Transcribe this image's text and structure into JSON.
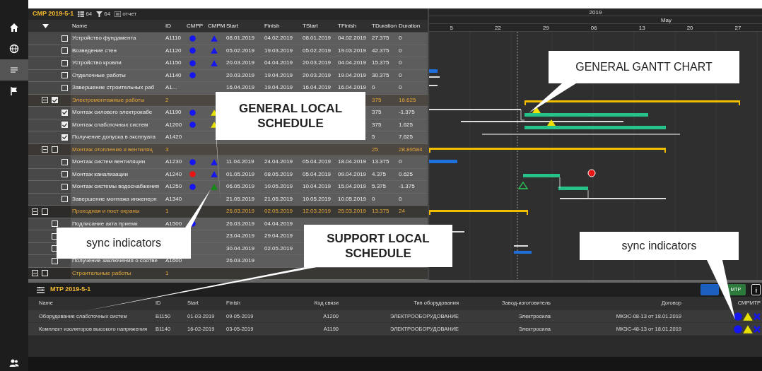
{
  "sidebar": {
    "items": [
      {
        "kind": "home",
        "selected": false
      },
      {
        "kind": "globe",
        "selected": false
      },
      {
        "kind": "list",
        "selected": true
      },
      {
        "kind": "flag",
        "selected": false
      }
    ],
    "bottom": {
      "kind": "users"
    }
  },
  "schedule": {
    "title": "CMP 2019-5-1",
    "tools": [
      {
        "kind": "grid",
        "text": "64"
      },
      {
        "kind": "filter",
        "text": "64"
      },
      {
        "kind": "report",
        "text": "отчет"
      }
    ],
    "columns": [
      "Name",
      "ID",
      "CMPP",
      "CMPM",
      "Start",
      "Finish",
      "TStart",
      "TFinish",
      "TDuration",
      "Duration"
    ],
    "rows": [
      {
        "kind": "continuation",
        "children": [
          {
            "kind": "continuation",
            "children": [
              {
                "kind": "task",
                "checked": false,
                "name": "Устройство фундамента",
                "id": "A1110",
                "cmpp": {
                  "color": "#1515f0"
                },
                "cmpm": {
                  "color": "#1515f0"
                },
                "start": "08.01.2019",
                "finish": "04.02.2019",
                "tstart": "08.01.2019",
                "tfinish": "04.02.2019",
                "tduration": "27.375",
                "duration": "0"
              },
              {
                "kind": "task",
                "checked": false,
                "name": "Возведение стен",
                "id": "A1120",
                "cmpp": {
                  "color": "#1515f0"
                },
                "cmpm": {
                  "color": "#1515f0"
                },
                "start": "05.02.2019",
                "finish": "19.03.2019",
                "tstart": "05.02.2019",
                "tfinish": "19.03.2019",
                "tduration": "42.375",
                "duration": "0"
              },
              {
                "kind": "task",
                "checked": false,
                "name": "Устройство кровли",
                "id": "A1150",
                "cmpp": {
                  "color": "#1515f0"
                },
                "cmpm": {
                  "color": "#1515f0"
                },
                "start": "20.03.2019",
                "finish": "04.04.2019",
                "tstart": "20.03.2019",
                "tfinish": "04.04.2019",
                "tduration": "15.375",
                "duration": "0"
              },
              {
                "kind": "task",
                "checked": false,
                "name": "Отделочные работы",
                "id": "A1140",
                "cmpp": {
                  "color": "#1515f0"
                },
                "start": "20.03.2019",
                "finish": "19.04.2019",
                "tstart": "20.03.2019",
                "tfinish": "19.04.2019",
                "tduration": "30.375",
                "duration": "0"
              },
              {
                "kind": "task",
                "checked": false,
                "name": "Завершение строительных раб",
                "id": "A1...",
                "start": "16.04.2019",
                "finish": "19.04.2019",
                "tstart": "16.04.2019",
                "tfinish": "16.04.2019",
                "tduration": "0",
                "duration": "0"
              }
            ]
          },
          {
            "kind": "group",
            "expanded": true,
            "checked": true,
            "name": "Электромонтажные работы",
            "id": "2",
            "tduration": "375",
            "duration": "16.625",
            "children": [
              {
                "kind": "task",
                "checked": true,
                "name": "Монтаж силового электрокабе",
                "id": "A1190",
                "cmpp": {
                  "color": "#1515f0"
                },
                "cmpm": {
                  "color": "#e8e000"
                },
                "tduration": "375",
                "duration": "-1.375"
              },
              {
                "kind": "task",
                "checked": true,
                "name": "Монтаж слаботочных систем",
                "id": "A1200",
                "cmpp": {
                  "color": "#1515f0"
                },
                "cmpm": {
                  "color": "#e8e000"
                },
                "tduration": "375",
                "duration": "1.625"
              },
              {
                "kind": "task",
                "checked": true,
                "name": "Получение допуска в эксплуата",
                "id": "A1420",
                "tduration": "5",
                "duration": "7.625"
              }
            ]
          },
          {
            "kind": "group",
            "expanded": true,
            "checked": false,
            "name": "Монтаж отопления и вентиляц",
            "id": "3",
            "tduration": "25",
            "duration": "28.89584",
            "children": [
              {
                "kind": "task",
                "checked": false,
                "name": "Монтаж систем вентиляции",
                "id": "A1230",
                "cmpp": {
                  "color": "#1515f0"
                },
                "cmpm": {
                  "color": "#1515f0"
                },
                "start": "11.04.2019",
                "finish": "24.04.2019",
                "tstart": "05.04.2019",
                "tfinish": "18.04.2019",
                "tduration": "13.375",
                "duration": "0"
              },
              {
                "kind": "task",
                "checked": false,
                "name": "Монтаж канализации",
                "id": "A1240",
                "cmpp": {
                  "color": "#e81515"
                },
                "cmpm": {
                  "color": "#1515f0"
                },
                "start": "01.05.2019",
                "finish": "08.05.2019",
                "tstart": "05.04.2019",
                "tfinish": "09.04.2019",
                "tduration": "4.375",
                "duration": "0.625"
              },
              {
                "kind": "task",
                "checked": false,
                "name": "Монтаж системы водоснабжения",
                "id": "A1250",
                "cmpp": {
                  "color": "#1515f0"
                },
                "cmpm": {
                  "color": "#158a15"
                },
                "start": "06.05.2019",
                "finish": "10.05.2019",
                "tstart": "10.04.2019",
                "tfinish": "15.04.2019",
                "tduration": "5.375",
                "duration": "-1.375"
              },
              {
                "kind": "task",
                "checked": false,
                "name": "Завершение монтажа инженерн",
                "id": "A1340",
                "start": "21.05.2019",
                "finish": "21.05.2019",
                "tstart": "10.05.2019",
                "tfinish": "10.05.2019",
                "tduration": "0",
                "duration": "0"
              }
            ]
          }
        ]
      },
      {
        "kind": "group",
        "expanded": true,
        "checked": false,
        "name": "Проходная и пост охраны",
        "id": "1",
        "start": "26.03.2019",
        "finish": "02.05.2019",
        "tstart": "12.03.2019",
        "tfinish": "25.03.2019",
        "tduration": "13.375",
        "duration": "24",
        "children": [
          {
            "kind": "task",
            "checked": false,
            "name": "Подписание акта приемк",
            "id": "A1500",
            "cmpp": {
              "color": "#1515f0"
            },
            "start": "26.03.2019",
            "finish": "04.04.2019"
          },
          {
            "kind": "task",
            "checked": false,
            "start": "23.04.2019",
            "finish": "29.04.2019"
          },
          {
            "kind": "task",
            "checked": false,
            "start": "30.04.2019",
            "finish": "02.05.2019"
          },
          {
            "kind": "task",
            "checked": false,
            "name": "Получение заключения о соотве",
            "id": "A1600",
            "start": "26.03.2019"
          }
        ]
      },
      {
        "kind": "group",
        "expanded": true,
        "checked": false,
        "name": "Строительные работы",
        "id": "1"
      }
    ]
  },
  "gantt": {
    "year": "2019",
    "month": "May",
    "weeks": [
      "5",
      "22",
      "29",
      "06",
      "13",
      "20",
      "27"
    ]
  },
  "support": {
    "title": "MTP 2019-5-1",
    "buttons": [
      {
        "kind": "primary"
      },
      {
        "kind": "success",
        "text": "МТР"
      },
      {
        "kind": "info",
        "text": "i"
      }
    ],
    "columns": [
      "Name",
      "ID",
      "Start",
      "Finish",
      "Код связи",
      "Тип оборудования",
      "Завод-изготовитель",
      "Договор",
      "СМРМТР"
    ],
    "rows": [
      {
        "cells": [
          "Оборудование слаботочных систем",
          "B1150",
          "01-03-2019",
          "09-05-2019",
          "A1200",
          "ЭЛЕКТРООБОРУДОВАНИЕ",
          "Электросила",
          "МКЭС-08-13 от 18.01.2019"
        ],
        "sync": [
          {
            "kind": "circle",
            "color": "#1515f0"
          },
          {
            "kind": "triangle",
            "color": "#e8e000"
          },
          {
            "kind": "cross",
            "color": "#1515f0"
          }
        ]
      },
      {
        "cells": [
          "Комплект изоляторов высокого напряжения",
          "B1140",
          "16-02-2019",
          "03-05-2019",
          "A1190",
          "ЭЛЕКТРООБОРУДОВАНИЕ",
          "Электросила",
          "МКЭС-48-13 от 18.01.2019"
        ],
        "sync": [
          {
            "kind": "circle",
            "color": "#1515f0"
          },
          {
            "kind": "triangle",
            "color": "#e8e000"
          },
          {
            "kind": "cross",
            "color": "#1515f0"
          }
        ]
      }
    ]
  },
  "callouts": [
    {
      "text": "GENERAL LOCAL SCHEDULE",
      "kind": "bold"
    },
    {
      "text": "GENERAL GANTT CHART",
      "kind": "plain"
    },
    {
      "text": "sync indicators",
      "kind": "plain"
    },
    {
      "text": "SUPPORT LOCAL SCHEDULE",
      "kind": "bold"
    },
    {
      "text": "sync indicators",
      "kind": "plain"
    }
  ]
}
